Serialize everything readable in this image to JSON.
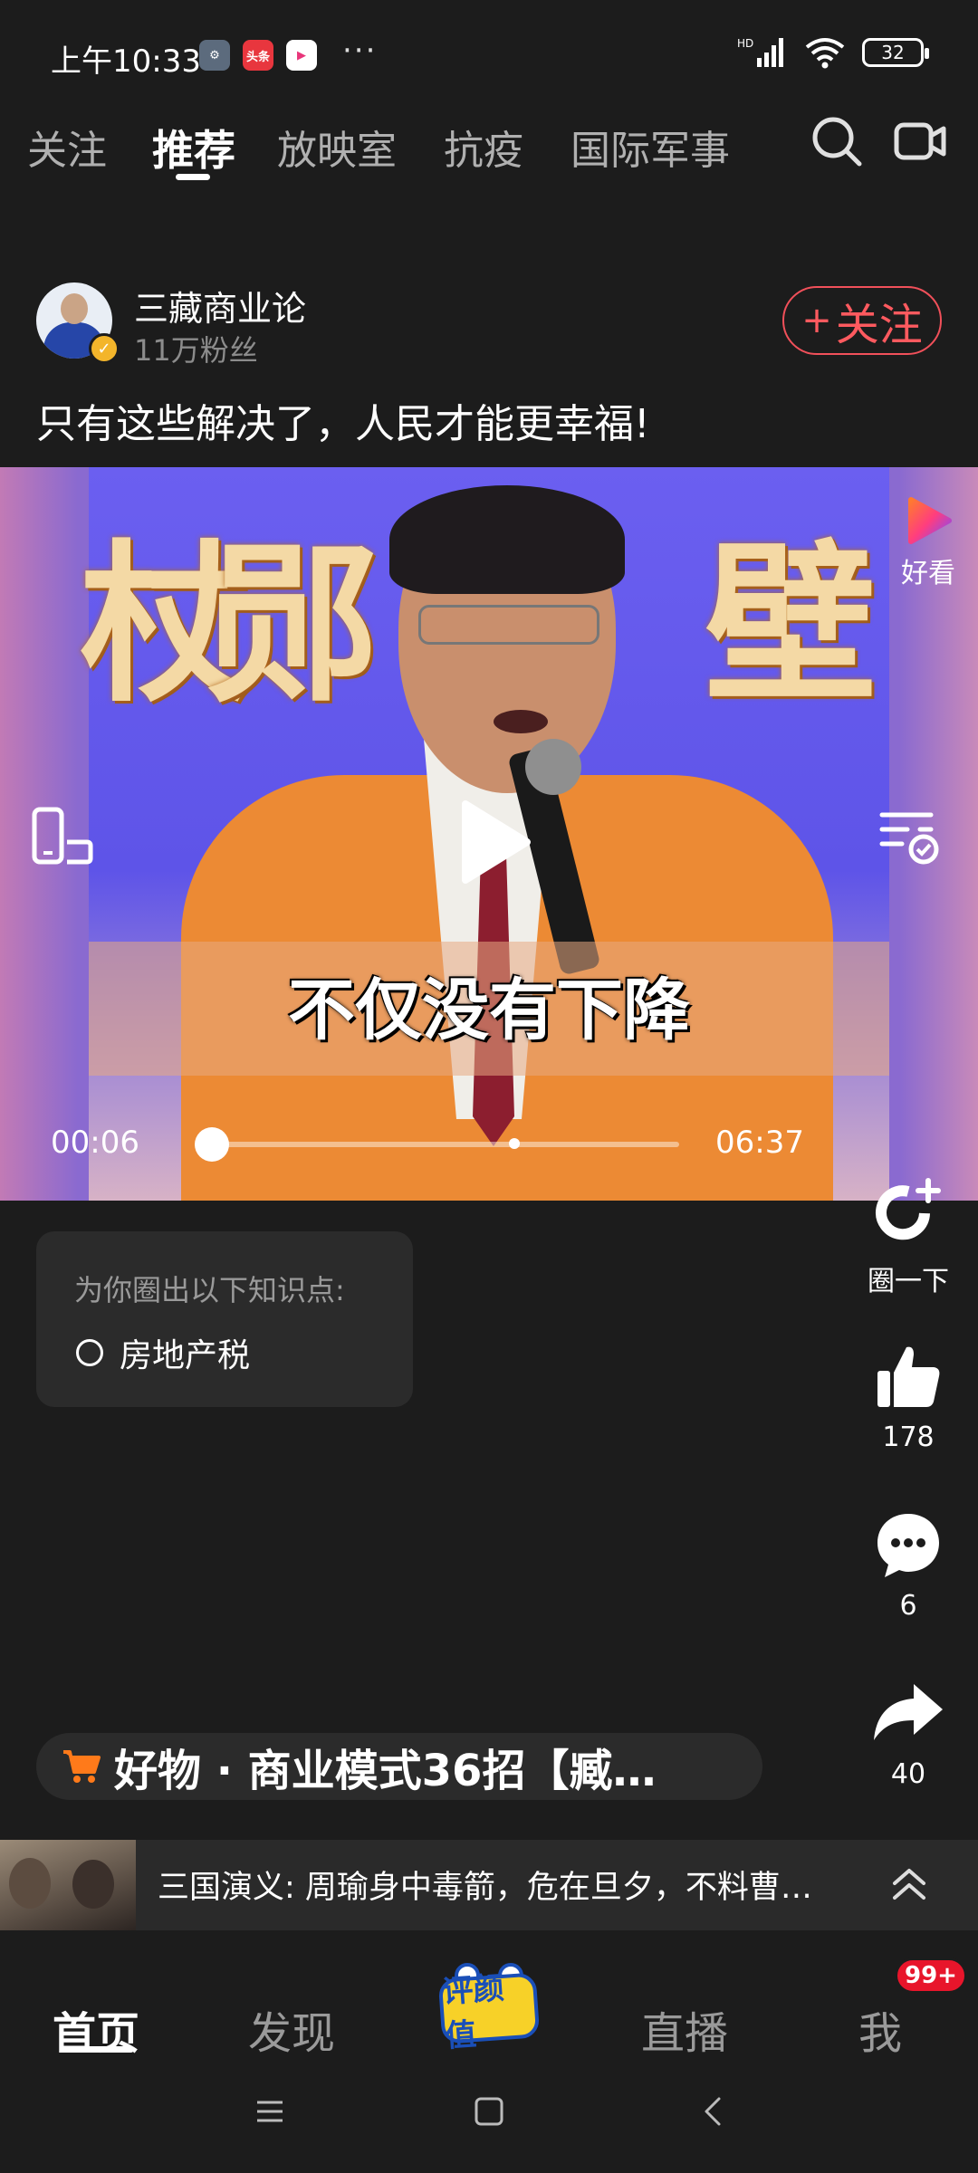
{
  "status_bar": {
    "time": "上午10:33",
    "notif_icons": [
      {
        "name": "settings-icon",
        "text": "⚙",
        "bg": "#5c6b7d"
      },
      {
        "name": "toutiao-icon",
        "text": "头条",
        "bg": "#e8363e"
      },
      {
        "name": "haokan-icon",
        "text": "▶",
        "bg": "#ffffff"
      }
    ],
    "more": "···",
    "signal_label": "HD",
    "battery": "32"
  },
  "top_tabs": [
    {
      "label": "关注",
      "active": false
    },
    {
      "label": "推荐",
      "active": true
    },
    {
      "label": "放映室",
      "active": false
    },
    {
      "label": "抗疫",
      "active": false
    },
    {
      "label": "国际军事",
      "active": false
    }
  ],
  "author": {
    "name": "三藏商业论",
    "fans": "11万粉丝",
    "follow_label": "关注",
    "follow_plus": "+"
  },
  "post": {
    "title": "只有这些解决了，人民才能更幸福!"
  },
  "video": {
    "subtitle": "不仅没有下降",
    "current_time": "00:06",
    "total_time": "06:37",
    "progress": 0.0151,
    "haokan_label": "好看"
  },
  "knowledge": {
    "header": "为你圈出以下知识点:",
    "items": [
      "房地产税"
    ]
  },
  "actions": {
    "circle_label": "圈一下",
    "likes": "178",
    "comments": "6",
    "shares": "40"
  },
  "product": {
    "text": "好物 · 商业模式36招【臧…"
  },
  "next_video": {
    "text": "三国演义: 周瑜身中毒箭，危在旦夕，不料曹…"
  },
  "bottom_nav": {
    "items": [
      {
        "label": "首页",
        "active": true
      },
      {
        "label": "发现",
        "active": false
      },
      {
        "label": "评颜值",
        "active": false
      },
      {
        "label": "直播",
        "active": false
      },
      {
        "label": "我",
        "active": false
      }
    ],
    "me_badge": "99+"
  },
  "colors": {
    "background": "#1c1c1c",
    "accent_red": "#ff5a5f",
    "badge_red": "#e8152b",
    "cart_orange": "#ff7a1a"
  }
}
